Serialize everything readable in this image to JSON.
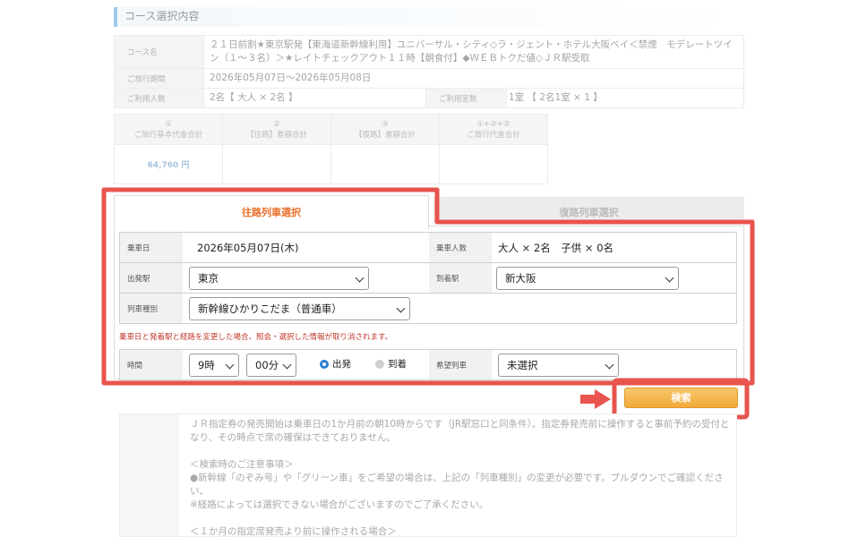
{
  "course_section": {
    "title": "コース選択内容",
    "rows": [
      {
        "label": "コース名",
        "value": "２１日前割★東京駅発【東海道新幹線利用】ユニバーサル・シティ◇ラ・ジェント・ホテル大阪ベイ＜禁煙　モデレートツイン（１～３名）＞★レイトチェックアウト１１時【朝食付】◆ＷＥＢトクだ値◇ＪＲ駅受取"
      },
      {
        "label": "ご旅行期間",
        "value": "2026年05月07日～2026年05月08日"
      },
      {
        "label": "ご利用人数",
        "value": "2名【 大人 × 2名 】",
        "label2": "ご利用室数",
        "value2": "1室 【 2名1室 × 1 】"
      }
    ]
  },
  "price_table": {
    "headers": [
      {
        "num": "①",
        "text": "ご旅行基本代金合計"
      },
      {
        "num": "②",
        "text": "【往路】差額合計"
      },
      {
        "num": "③",
        "text": "【復路】差額合計"
      },
      {
        "num": "①+②+③",
        "text": "ご旅行代金合計"
      }
    ],
    "values": [
      "64,760 円",
      "",
      "",
      ""
    ]
  },
  "tabs": {
    "outbound": "往路列車選択",
    "return": "復路列車選択"
  },
  "form": {
    "boarding_date_label": "乗車日",
    "boarding_date_value": "2026年05月07日(木)",
    "passengers_label": "乗車人数",
    "passengers_value": "大人 × 2名　子供 × 0名",
    "departure_label": "出発駅",
    "departure_value": "東京",
    "arrival_label": "到着駅",
    "arrival_value": "新大阪",
    "train_type_label": "列車種別",
    "train_type_value": "新幹線ひかりこだま（普通車）",
    "notice": "乗車日と発着駅と経路を変更した場合、照会・選択した情報が取り消されます。",
    "time_label": "時間",
    "hour_value": "9時",
    "minute_value": "00分",
    "radio_depart": "出発",
    "radio_arrive": "到着",
    "train_pref_label": "希望列車",
    "train_pref_value": "未選択"
  },
  "search_button": "検索",
  "notes": {
    "p1": "ＪＲ指定券の発売開始は乗車日の1か月前の朝10時からです（JR駅窓口と同条件）。指定券発売前に操作すると事前予約の受付となり、その時点で席の確保はできておりません。",
    "p2_title": "＜検索時のご注意事項＞",
    "p2_l1": "●新幹線「のぞみ号」や「グリーン車」をご希望の場合は、上記の「列車種別」の変更が必要です。プルダウンでご確認ください。",
    "p2_l2": "※経路によっては選択できない場合がございますのでご了承ください。",
    "p3_title": "＜１か月の指定席発売より前に操作される場合＞"
  },
  "colors": {
    "highlight": "#e8544e",
    "accent": "#e96f2a",
    "button": "#f1a93a"
  }
}
